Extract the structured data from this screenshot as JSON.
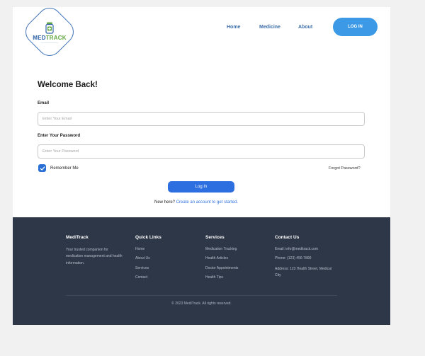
{
  "header": {
    "logo_text_a": "MED",
    "logo_text_b": "TRACK",
    "nav": [
      "Home",
      "Medicine",
      "About"
    ],
    "login_button": "LOG IN"
  },
  "form": {
    "title": "Welcome Back!",
    "email_label": "Email",
    "email_placeholder": "Enter Your Email",
    "password_label": "Enter Your Password",
    "password_placeholder": "Enter Your Password",
    "remember_label": "Remember Me",
    "remember_checked": true,
    "forgot_link": "Forgot Password?",
    "submit_button": "Log In",
    "new_here_text": "New here?",
    "create_account_link": "Create an account to get started."
  },
  "footer": {
    "brand": {
      "title": "MediTrack",
      "description": "Your trusted companion for medication management and health information."
    },
    "quick_links": {
      "title": "Quick Links",
      "items": [
        "Home",
        "About Us",
        "Services",
        "Contact"
      ]
    },
    "services": {
      "title": "Services",
      "items": [
        "Medication Tracking",
        "Health Articles",
        "Doctor Appointments",
        "Health Tips"
      ]
    },
    "contact": {
      "title": "Contact Us",
      "email": "Email: info@meditrack.com",
      "phone": "Phone: (123) 456-7890",
      "address": "Address: 123 Health Street, Medical City"
    },
    "copyright": "© 2023 MediTrack. All rights reserved."
  },
  "colors": {
    "accent": "#3b99e6",
    "primary_button": "#2d6fe0",
    "footer_bg": "#2e3748",
    "brand_blue": "#2f63a8",
    "brand_green": "#63a844"
  }
}
